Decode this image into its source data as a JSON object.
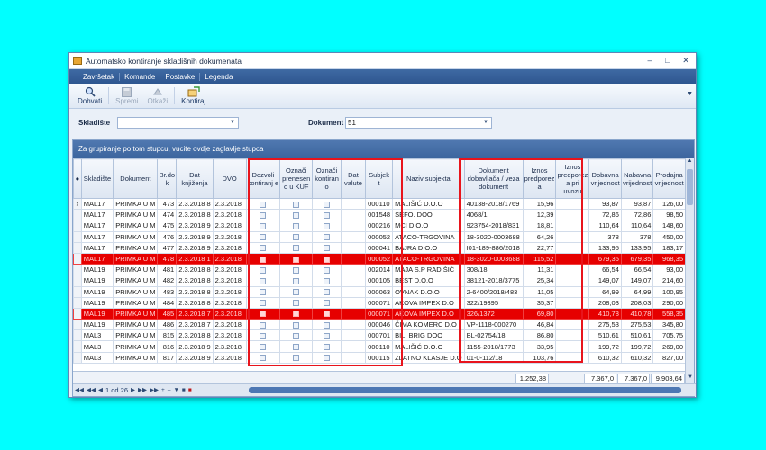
{
  "window": {
    "title": "Automatsko kontiranje skladišnih dokumenata"
  },
  "menu": [
    "Završetak",
    "Komande",
    "Postavke",
    "Legenda"
  ],
  "toolbar": {
    "buttons": [
      {
        "label": "Dohvati",
        "icon": "magnifier-icon",
        "enabled": true
      },
      {
        "label": "Spremi",
        "icon": "save-icon",
        "enabled": false
      },
      {
        "label": "Otkaži",
        "icon": "cancel-icon",
        "enabled": false
      },
      {
        "label": "Kontiraj",
        "icon": "post-icon",
        "enabled": true
      }
    ]
  },
  "filters": {
    "skladiste_label": "Skladište",
    "skladiste_value": "",
    "dokument_label": "Dokument",
    "dokument_value": "51"
  },
  "grid": {
    "group_hint": "Za grupiranje po tom stupcu, vucite ovdje zaglavlje stupca",
    "columns": [
      "Skladište",
      "Dokument",
      "Br.do k",
      "Dat knjiženja",
      "DVO",
      "Dozvoli kontiranj e",
      "Označi prenesen o u KUF",
      "Označi kontiran o",
      "Dat valute",
      "Subjek t",
      "Naziv subjekta",
      "Dokument dobavljača / veza dokument",
      "Iznos predporez a",
      "Iznos predporez a pri uvozu",
      "Dobavna vrijednost",
      "Nabavna vrijednost",
      "Prodajna vrijednost"
    ],
    "rows": [
      {
        "sel": true,
        "hl": false,
        "cells": [
          "MAL17",
          "PRIMKA U M",
          "473",
          "2.3.2018 8",
          "2.3.2018",
          "",
          "",
          "",
          "",
          "000110",
          "MALIŠIĆ D.O.O",
          "40138-2018/1769",
          "15,96",
          "",
          "93,87",
          "93,87",
          "126,00"
        ]
      },
      {
        "sel": false,
        "hl": false,
        "cells": [
          "MAL17",
          "PRIMKA U M",
          "474",
          "2.3.2018 8",
          "2.3.2018",
          "",
          "",
          "",
          "",
          "001548",
          "SEFO. DOO",
          "4068/1",
          "12,39",
          "",
          "72,86",
          "72,86",
          "98,50"
        ]
      },
      {
        "sel": false,
        "hl": false,
        "cells": [
          "MAL17",
          "PRIMKA U M",
          "475",
          "2.3.2018 9",
          "2.3.2018",
          "",
          "",
          "",
          "",
          "000216",
          "MCI D.O.O",
          "923754-2018/831",
          "18,81",
          "",
          "110,64",
          "110,64",
          "148,60"
        ]
      },
      {
        "sel": false,
        "hl": false,
        "cells": [
          "MAL17",
          "PRIMKA U M",
          "476",
          "2.3.2018 9",
          "2.3.2018",
          "",
          "",
          "",
          "",
          "000052",
          "ATACO-TRGOVINA",
          "18-3020-0003688",
          "64,26",
          "",
          "378",
          "378",
          "450,00"
        ]
      },
      {
        "sel": false,
        "hl": false,
        "cells": [
          "MAL17",
          "PRIMKA U M",
          "477",
          "2.3.2018 9",
          "2.3.2018",
          "",
          "",
          "",
          "",
          "000041",
          "BAJRA D.O.O",
          "I01-189-886/2018",
          "22,77",
          "",
          "133,95",
          "133,95",
          "183,17"
        ]
      },
      {
        "sel": false,
        "hl": true,
        "cells": [
          "MAL17",
          "PRIMKA U M",
          "478",
          "2.3.2018 1",
          "2.3.2018",
          "",
          "",
          "",
          "",
          "000052",
          "ATACO-TRGOVINA",
          "18-3020-0003688",
          "115,52",
          "",
          "679,35",
          "679,35",
          "968,35"
        ]
      },
      {
        "sel": false,
        "hl": false,
        "cells": [
          "MAL19",
          "PRIMKA U M",
          "481",
          "2.3.2018 8",
          "2.3.2018",
          "",
          "",
          "",
          "",
          "002014",
          "MAJA S.P RADIŠIĆ",
          "308/18",
          "11,31",
          "",
          "66,54",
          "66,54",
          "93,00"
        ]
      },
      {
        "sel": false,
        "hl": false,
        "cells": [
          "MAL19",
          "PRIMKA U M",
          "482",
          "2.3.2018 8",
          "2.3.2018",
          "",
          "",
          "",
          "",
          "000105",
          "BEST D.O.O",
          "38121-2018/3775",
          "25,34",
          "",
          "149,07",
          "149,07",
          "214,60"
        ]
      },
      {
        "sel": false,
        "hl": false,
        "cells": [
          "MAL19",
          "PRIMKA U M",
          "483",
          "2.3.2018 8",
          "2.3.2018",
          "",
          "",
          "",
          "",
          "000063",
          "OVNAK D.O.O",
          "2-6400/2018/483",
          "11,05",
          "",
          "64,99",
          "64,99",
          "100,95"
        ]
      },
      {
        "sel": false,
        "hl": false,
        "cells": [
          "MAL19",
          "PRIMKA U M",
          "484",
          "2.3.2018 8",
          "2.3.2018",
          "",
          "",
          "",
          "",
          "000071",
          "AKOVA IMPEX D.O",
          "322/19395",
          "35,37",
          "",
          "208,03",
          "208,03",
          "290,00"
        ]
      },
      {
        "sel": false,
        "hl": true,
        "cells": [
          "MAL19",
          "PRIMKA U M",
          "485",
          "2.3.2018 7",
          "2.3.2018",
          "",
          "",
          "",
          "",
          "000071",
          "AKOVA IMPEX D.O",
          "326/1372",
          "69,80",
          "",
          "410,78",
          "410,78",
          "558,35"
        ]
      },
      {
        "sel": false,
        "hl": false,
        "cells": [
          "MAL19",
          "PRIMKA U M",
          "486",
          "2.3.2018 7",
          "2.3.2018",
          "",
          "",
          "",
          "",
          "000046",
          "ČIMA KOMERC D.O",
          "VP-1118-000270",
          "46,84",
          "",
          "275,53",
          "275,53",
          "345,80"
        ]
      },
      {
        "sel": false,
        "hl": false,
        "cells": [
          "MAL3",
          "PRIMKA U M",
          "815",
          "2.3.2018 8",
          "2.3.2018",
          "",
          "",
          "",
          "",
          "000701",
          "BILI BRIG DOO",
          "BL-02754/18",
          "86,80",
          "",
          "510,61",
          "510,61",
          "705,75"
        ]
      },
      {
        "sel": false,
        "hl": false,
        "cells": [
          "MAL3",
          "PRIMKA U M",
          "816",
          "2.3.2018 9",
          "2.3.2018",
          "",
          "",
          "",
          "",
          "000110",
          "MALIŠIĆ D.O.O",
          "1155-2018/1773",
          "33,95",
          "",
          "199,72",
          "199,72",
          "269,00"
        ]
      },
      {
        "sel": false,
        "hl": false,
        "cells": [
          "MAL3",
          "PRIMKA U M",
          "817",
          "2.3.2018 9",
          "2.3.2018",
          "",
          "",
          "",
          "",
          "000115",
          "ZLATNO KLASJE D.O",
          "01-0-112/18",
          "103,76",
          "",
          "610,32",
          "610,32",
          "827,00"
        ]
      }
    ],
    "totals": {
      "iznos_predporeza": "1.252,38",
      "dobavna": "7.367,0",
      "nabavna": "7.367,0",
      "prodajna": "9.903,64"
    }
  },
  "pager": {
    "text": "1 od 26"
  },
  "colors": {
    "highlight_row": "#e60000",
    "annotation_box": "#e8141c",
    "menubar": "#2e5690",
    "background": "#00ffff"
  }
}
